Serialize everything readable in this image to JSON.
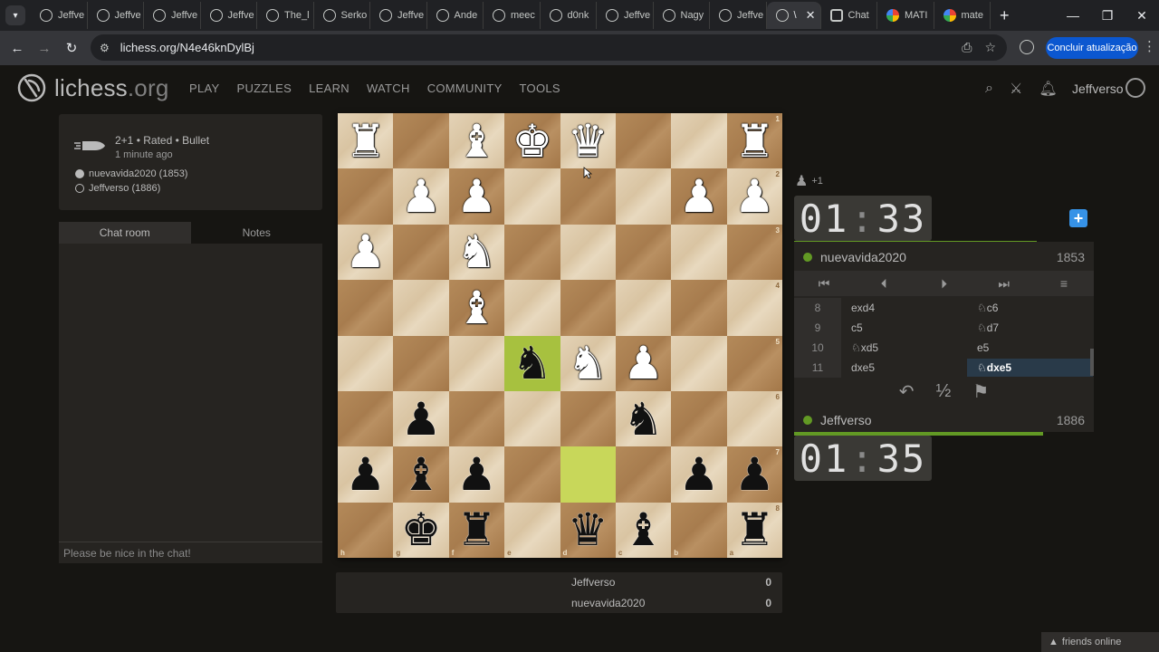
{
  "browser": {
    "tabs": [
      {
        "label": "Jeffve",
        "icon": "lichess-icon"
      },
      {
        "label": "Jeffve",
        "icon": "lichess-icon"
      },
      {
        "label": "Jeffve",
        "icon": "lichess-icon"
      },
      {
        "label": "Jeffve",
        "icon": "lichess-icon"
      },
      {
        "label": "The_l",
        "icon": "lichess-icon"
      },
      {
        "label": "Serko",
        "icon": "lichess-icon"
      },
      {
        "label": "Jeffve",
        "icon": "lichess-icon"
      },
      {
        "label": "Ande",
        "icon": "lichess-icon"
      },
      {
        "label": "meec",
        "icon": "lichess-icon"
      },
      {
        "label": "d0nk",
        "icon": "lichess-icon"
      },
      {
        "label": "Jeffve",
        "icon": "lichess-icon"
      },
      {
        "label": "Nagy",
        "icon": "lichess-icon"
      },
      {
        "label": "Jeffve",
        "icon": "lichess-icon"
      },
      {
        "label": "\\",
        "icon": "lichess-icon"
      },
      {
        "label": "Chat",
        "icon": "chatgpt-icon"
      },
      {
        "label": "MATI",
        "icon": "google-icon"
      },
      {
        "label": "mate",
        "icon": "google-icon"
      }
    ],
    "url": "lichess.org/N4e46knDylBj",
    "update_button": "Concluir atualização"
  },
  "site": {
    "logo_main": "lichess",
    "logo_tld": ".org",
    "nav": [
      "PLAY",
      "PUZZLES",
      "LEARN",
      "WATCH",
      "COMMUNITY",
      "TOOLS"
    ],
    "username": "Jeffverso"
  },
  "game_info": {
    "title": "2+1 • Rated • Bullet",
    "time_ago": "1 minute ago",
    "white_player": "nuevavida2020 (1853)",
    "black_player": "Jeffverso (1886)"
  },
  "chat": {
    "tabs": [
      "Chat room",
      "Notes"
    ],
    "placeholder": "Please be nice in the chat!"
  },
  "board": {
    "orientation": "black",
    "ranks": [
      "1",
      "2",
      "3",
      "4",
      "5",
      "6",
      "7",
      "8"
    ],
    "files": [
      "h",
      "g",
      "f",
      "e",
      "d",
      "c",
      "b",
      "a"
    ],
    "rows": [
      [
        "wR",
        "",
        "wB",
        "wK",
        "wQ",
        "",
        "",
        "wR"
      ],
      [
        "",
        "wP",
        "wP",
        "",
        "",
        "",
        "wP",
        "wP"
      ],
      [
        "wP",
        "",
        "wN",
        "",
        "",
        "",
        "",
        ""
      ],
      [
        "",
        "",
        "wB",
        "",
        "",
        "",
        "",
        ""
      ],
      [
        "",
        "",
        "",
        "bN",
        "wN",
        "wP",
        "",
        ""
      ],
      [
        "",
        "bP",
        "",
        "",
        "",
        "bN",
        "",
        ""
      ],
      [
        "bP",
        "bB",
        "bP",
        "",
        "",
        "",
        "bP",
        "bP"
      ],
      [
        "",
        "bK",
        "bR",
        "",
        "bQ",
        "bB",
        "",
        "bR"
      ]
    ],
    "highlights": {
      "last_move_from": "d7",
      "last_move_to": "e5"
    }
  },
  "scores": [
    {
      "name": "Jeffverso",
      "value": "0"
    },
    {
      "name": "nuevavida2020",
      "value": "0"
    }
  ],
  "right": {
    "material": "+1",
    "opponent_clock": {
      "min": "01",
      "sec": "33"
    },
    "opponent_name": "nuevavida2020",
    "opponent_rating": "1853",
    "player_clock": {
      "min": "01",
      "sec": "35"
    },
    "player_name": "Jeffverso",
    "player_rating": "1886",
    "controls": [
      "⏮",
      "⏴",
      "⏵",
      "⏭",
      "≡"
    ],
    "moves": [
      {
        "num": "8",
        "white": "exd4",
        "black": "♘c6"
      },
      {
        "num": "9",
        "white": "c5",
        "black": "♘d7"
      },
      {
        "num": "10",
        "white": "♘xd5",
        "black": "e5"
      },
      {
        "num": "11",
        "white": "dxe5",
        "black": "♘dxe5"
      }
    ],
    "actions": [
      "↶",
      "½",
      "⚑"
    ],
    "opponent_clock_fill": 0.81,
    "player_clock_fill": 0.83
  },
  "footer": {
    "friends": "friends online"
  }
}
